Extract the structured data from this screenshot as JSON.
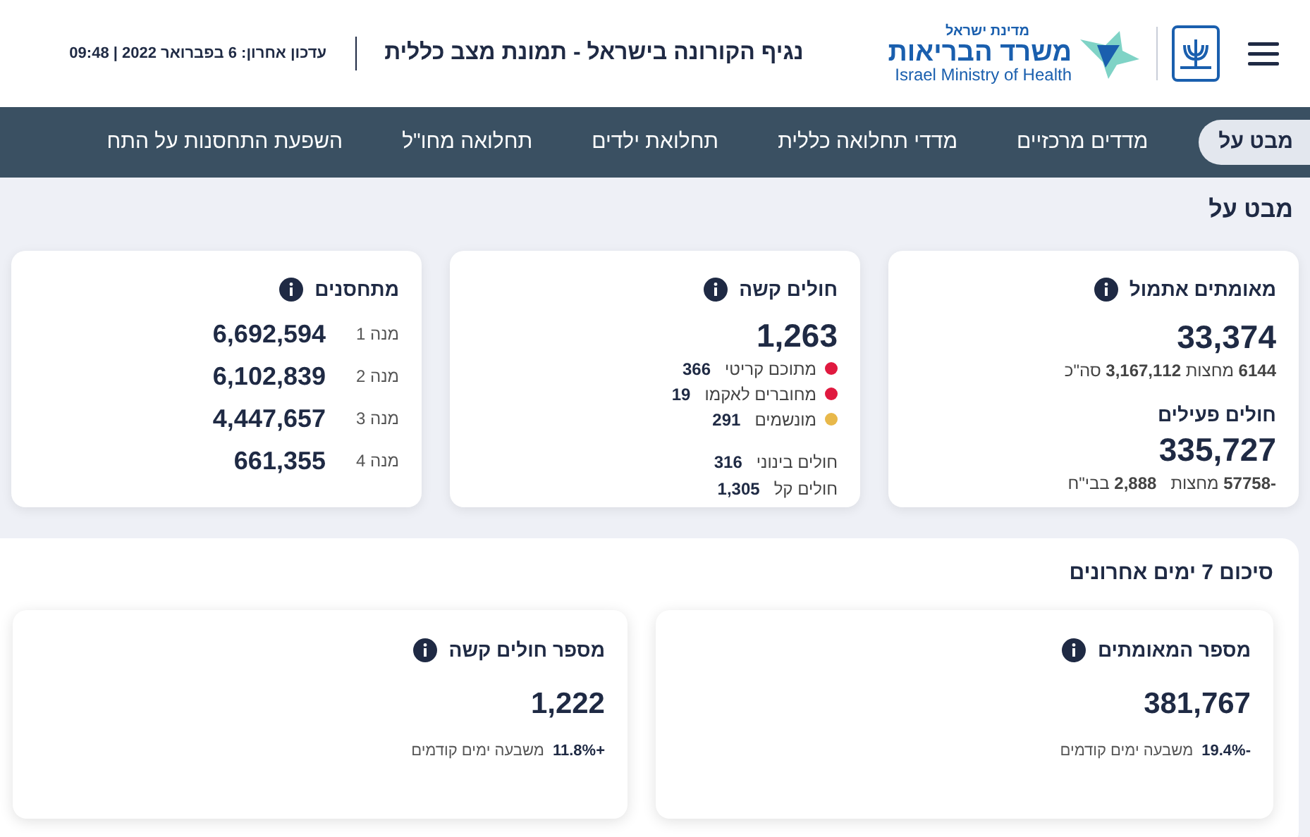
{
  "header": {
    "logo": {
      "state": "מדינת ישראל",
      "ministry": "משרד הבריאות",
      "ministry_en": "Israel Ministry of Health"
    },
    "title": "נגיף הקורונה בישראל - תמונת מצב כללית",
    "updated": "עדכון אחרון: 6 בפברואר 2022 | 09:48"
  },
  "tabs": [
    {
      "label": "מבט על",
      "selected": true
    },
    {
      "label": "מדדים מרכזיים",
      "selected": false
    },
    {
      "label": "מדדי תחלואה כללית",
      "selected": false
    },
    {
      "label": "תחלואת ילדים",
      "selected": false
    },
    {
      "label": "תחלואה מחו\"ל",
      "selected": false
    },
    {
      "label": "השפעת התחסנות על התח",
      "selected": false
    }
  ],
  "page_title": "מבט על",
  "cards": [
    {
      "kind": "confirmed",
      "title": "מאומתים אתמול",
      "value": "33,374",
      "detail": "**6144** מחצות **3,167,112** סה\"כ",
      "subtitle": "חולים פעילים",
      "subvalue": "335,727",
      "subdetail": "**-57758** מחצות   **2,888** בבי\"ח"
    },
    {
      "kind": "severe",
      "title": "חולים קשה",
      "value": "1,263",
      "items": [
        {
          "label": "מתוכם קריטי",
          "value": "366",
          "color": "#e0193f"
        },
        {
          "label": "מחוברים לאקמו",
          "value": "19",
          "color": "#e0193f"
        },
        {
          "label": "מונשמים",
          "value": "291",
          "color": "#e8b84a"
        }
      ],
      "extra": [
        {
          "label": "חולים בינוני",
          "value": "316"
        },
        {
          "label": "חולים קל",
          "value": "1,305"
        }
      ]
    },
    {
      "kind": "vaccinated",
      "title": "מתחסנים",
      "doses": [
        {
          "label": "מנה 1",
          "value": "6,692,594"
        },
        {
          "label": "מנה 2",
          "value": "6,102,839"
        },
        {
          "label": "מנה 3",
          "value": "4,447,657"
        },
        {
          "label": "מנה 4",
          "value": "661,355"
        }
      ]
    }
  ],
  "summary": {
    "title": "סיכום 7 ימים אחרונים",
    "cards": [
      {
        "title": "מספר המאומתים",
        "value": "381,767",
        "change": "-19.4%",
        "change_label": "משבעה ימים קודמים"
      },
      {
        "title": "מספר חולים קשה",
        "value": "1,222",
        "change": "+11.8%",
        "change_label": "משבעה ימים קודמים"
      }
    ]
  }
}
